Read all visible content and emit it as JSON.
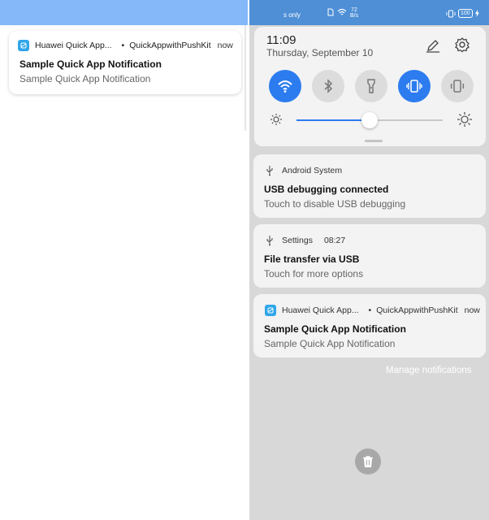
{
  "left_panel": {
    "notification": {
      "app_name": "Huawei Quick App...",
      "separator": "•",
      "channel": "QuickAppwithPushKit",
      "time": "now",
      "title": "Sample Quick App Notification",
      "body": "Sample Quick App Notification"
    }
  },
  "status_bar": {
    "left_text": "s only",
    "speed_value": "72",
    "speed_unit": "B/s",
    "battery": "100"
  },
  "quick_settings": {
    "time": "11:09",
    "date": "Thursday, September 10",
    "toggles": [
      {
        "name": "wifi-icon",
        "on": true
      },
      {
        "name": "bluetooth-icon",
        "on": false
      },
      {
        "name": "flashlight-icon",
        "on": false
      },
      {
        "name": "vibrate-icon",
        "on": true
      },
      {
        "name": "auto-rotate-icon",
        "on": false
      }
    ],
    "brightness_level": 0.5
  },
  "notifications": [
    {
      "app_name": "Android System",
      "icon": "usb-icon",
      "title": "USB debugging connected",
      "body": "Touch to disable USB debugging"
    },
    {
      "app_name": "Settings",
      "time": "08:27",
      "icon": "usb-icon",
      "title": "File transfer via USB",
      "body": "Touch for more options"
    },
    {
      "app_name": "Huawei Quick App...",
      "separator": "•",
      "channel": "QuickAppwithPushKit",
      "time": "now",
      "icon": "quick-app-icon",
      "title": "Sample Quick App Notification",
      "body": "Sample Quick App Notification"
    }
  ],
  "manage_notifications": "Manage notifications",
  "colors": {
    "accent": "#2c7cf0",
    "status_bar": "#4e8fd6",
    "left_header": "#84b8f8",
    "shade_bg": "#d8d8d8"
  }
}
